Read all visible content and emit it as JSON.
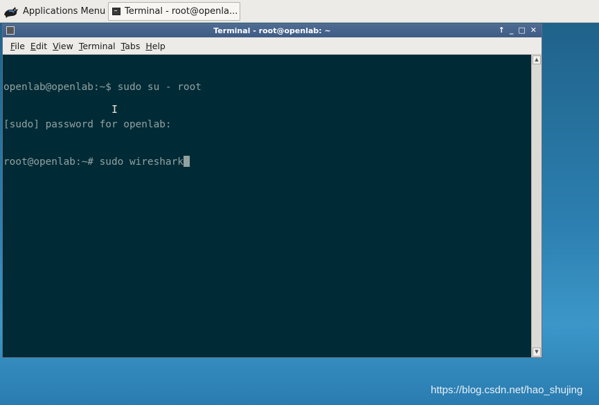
{
  "panel": {
    "app_menu_label": "Applications Menu",
    "task_label": "Terminal - root@openla..."
  },
  "window": {
    "title": "Terminal - root@openlab: ~",
    "controls": {
      "pin": "↑",
      "minimize": "_",
      "maximize": "□",
      "close": "✕"
    }
  },
  "menubar": {
    "file": "File",
    "edit": "Edit",
    "view": "View",
    "terminal": "Terminal",
    "tabs": "Tabs",
    "help": "Help"
  },
  "terminal": {
    "lines": [
      "openlab@openlab:~$ sudo su - root",
      "[sudo] password for openlab:",
      "root@openlab:~# sudo wireshark"
    ],
    "colors": {
      "background": "#002b36",
      "foreground": "#93a1a1"
    }
  },
  "watermark": "https://blog.csdn.net/hao_shujing"
}
